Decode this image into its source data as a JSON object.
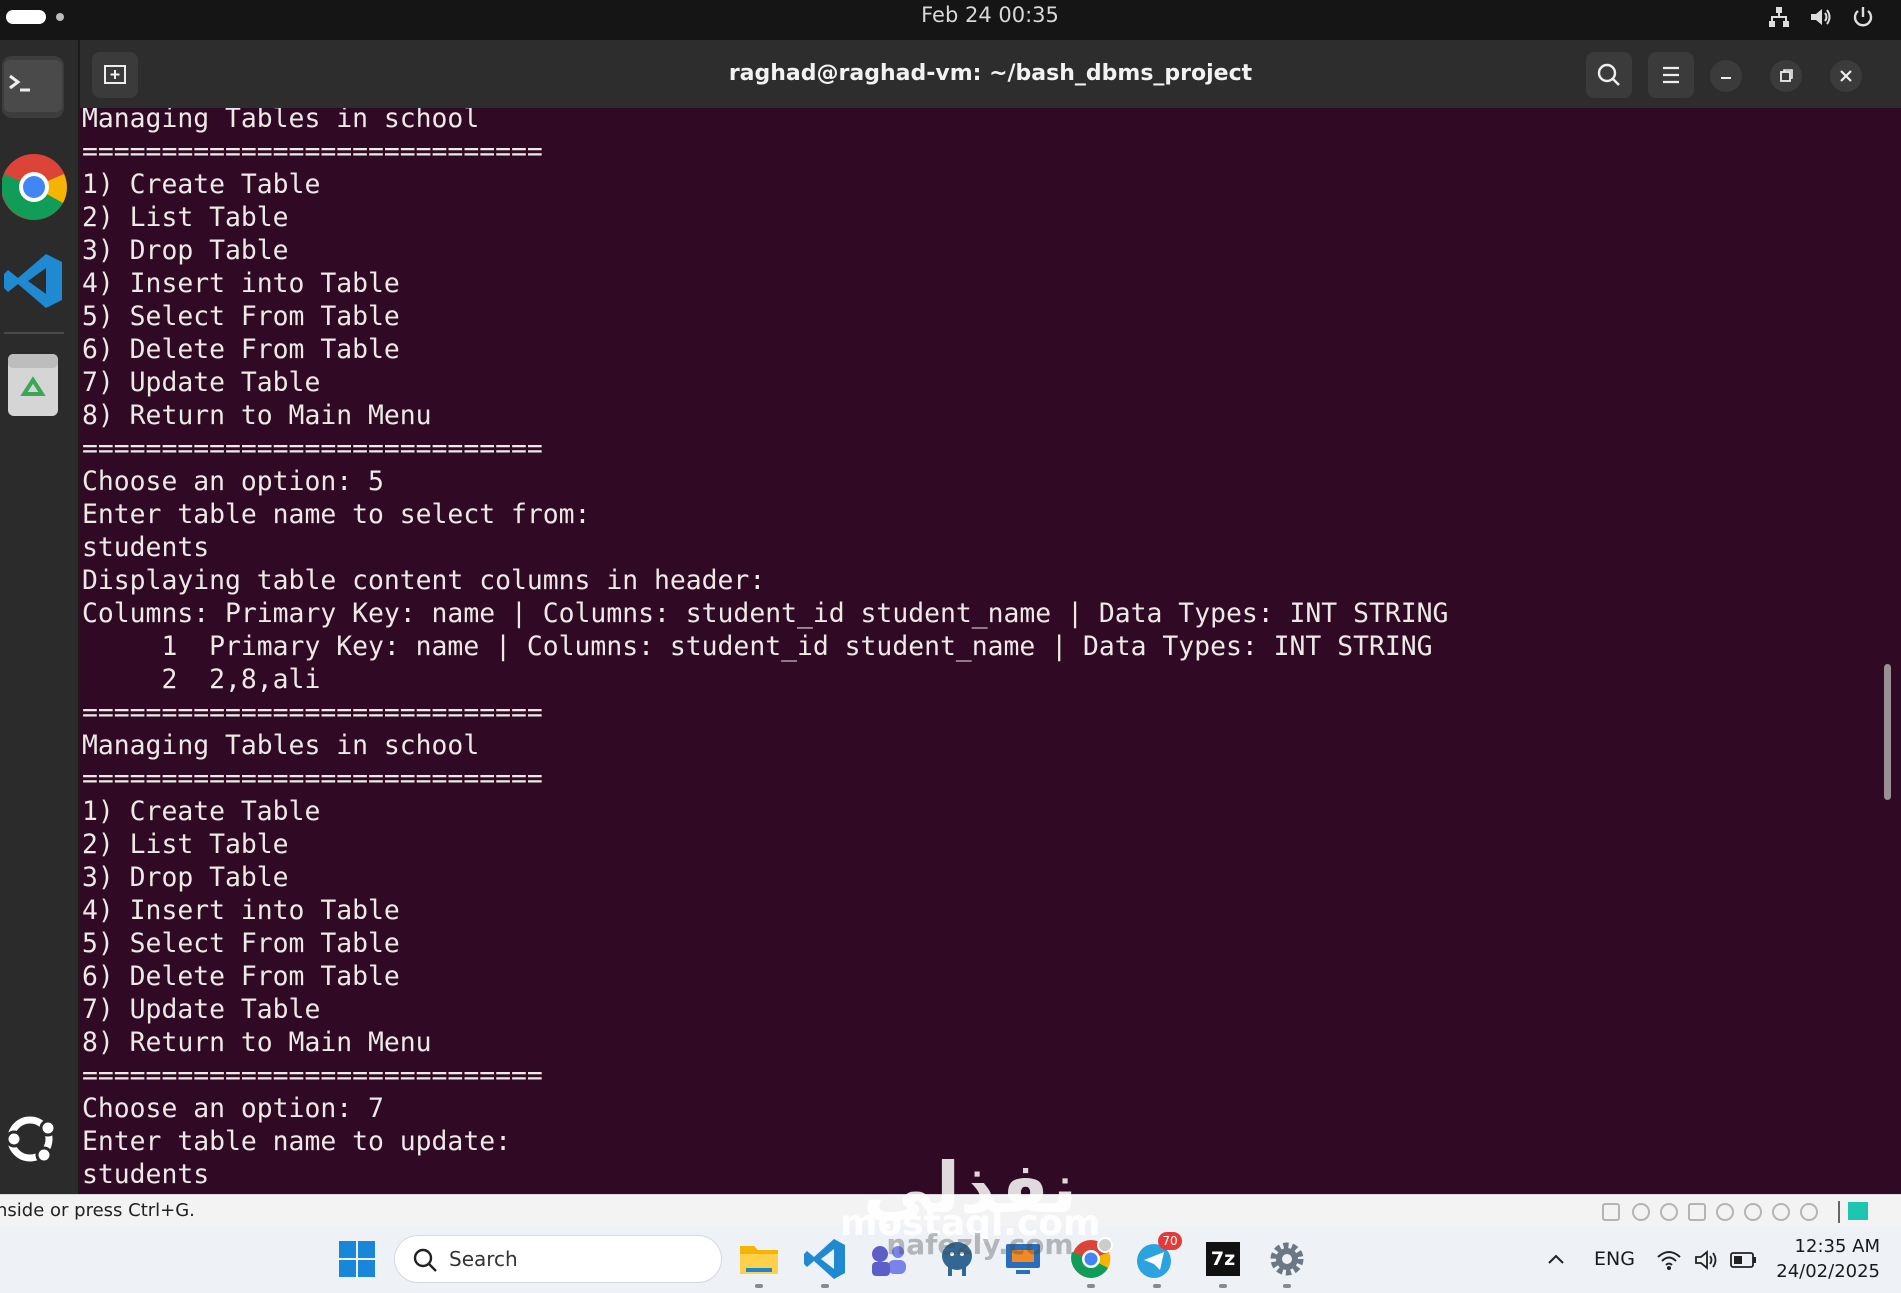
{
  "topbar": {
    "clock": "Feb 24  00:35",
    "icons": [
      "network-icon",
      "volume-icon",
      "power-icon"
    ]
  },
  "dock": {
    "items": [
      "terminal-icon",
      "chrome-icon",
      "vscode-icon",
      "trash-icon"
    ],
    "bottom": "ubuntu-logo-icon"
  },
  "window": {
    "title": "raghad@raghad-vm: ~/bash_dbms_project",
    "buttons": [
      "new-tab-icon",
      "search-icon",
      "hamburger-menu-icon",
      "minimize-icon",
      "maximize-icon",
      "close-icon"
    ]
  },
  "terminal": {
    "lines": [
      "Managing Tables in school",
      "=============================",
      "1) Create Table",
      "2) List Table",
      "3) Drop Table",
      "4) Insert into Table",
      "5) Select From Table",
      "6) Delete From Table",
      "7) Update Table",
      "8) Return to Main Menu",
      "=============================",
      "Choose an option: 5",
      "Enter table name to select from:",
      "students",
      "Displaying table content columns in header:",
      "Columns: Primary Key: name | Columns: student_id student_name | Data Types: INT STRING",
      "     1  Primary Key: name | Columns: student_id student_name | Data Types: INT STRING",
      "     2  2,8,ali",
      "=============================",
      "Managing Tables in school",
      "=============================",
      "1) Create Table",
      "2) List Table",
      "3) Drop Table",
      "4) Insert into Table",
      "5) Select From Table",
      "6) Delete From Table",
      "7) Update Table",
      "8) Return to Main Menu",
      "=============================",
      "Choose an option: 7",
      "Enter table name to update:",
      "students"
    ]
  },
  "statusbar": {
    "text": "nside or press Ctrl+G."
  },
  "taskbar": {
    "search_label": "Search",
    "apps": [
      "windows-start-icon",
      "file-explorer-icon",
      "vscode-icon",
      "teams-icon",
      "postgres-icon",
      "remote-desktop-icon",
      "chrome-icon",
      "telegram-icon",
      "7zip-icon",
      "settings-icon"
    ],
    "telegram_badge": "70",
    "zip_label": "7z",
    "language": "ENG",
    "time": "12:35 AM",
    "date": "24/02/2025"
  },
  "watermark": {
    "arabic": "نفذلي",
    "line1": "mostaql.com",
    "line2": "nafezly.com"
  },
  "colors": {
    "terminal_bg": "#300a24",
    "terminal_fg": "#ece9e6",
    "headerbar": "#2d2d2d"
  }
}
